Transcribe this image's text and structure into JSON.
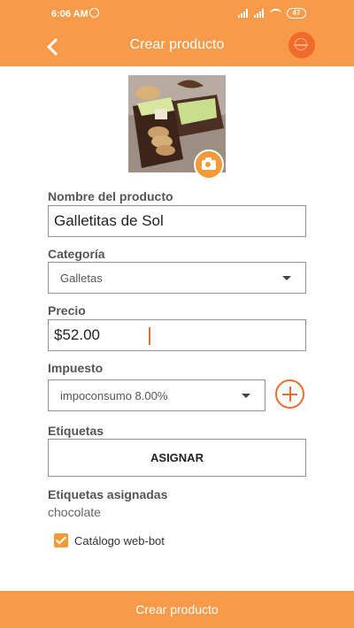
{
  "status": {
    "time": "6:06 AM",
    "battery": "47"
  },
  "header": {
    "title": "Crear producto"
  },
  "form": {
    "name_label": "Nombre del producto",
    "name_value": "Galletitas de Sol",
    "category_label": "Categoría",
    "category_value": "Galletas",
    "price_label": "Precio",
    "price_value": "$52.00",
    "tax_label": "Impuesto",
    "tax_value": "impoconsumo 8.00%",
    "tags_label": "Etiquetas",
    "assign_label": "ASIGNAR",
    "assigned_label": "Etiquetas asignadas",
    "assigned_value": "chocolate",
    "catalog_label": "Catálogo web-bot",
    "catalog_checked": true
  },
  "footer": {
    "submit_label": "Crear producto"
  },
  "icons": {
    "back": "arrow-back-icon",
    "globe": "globe-icon",
    "camera": "camera-icon",
    "add": "add-circle-icon",
    "dropdown": "chevron-down-icon"
  },
  "colors": {
    "primary": "#f79a4a",
    "accent": "#f06a2a"
  }
}
